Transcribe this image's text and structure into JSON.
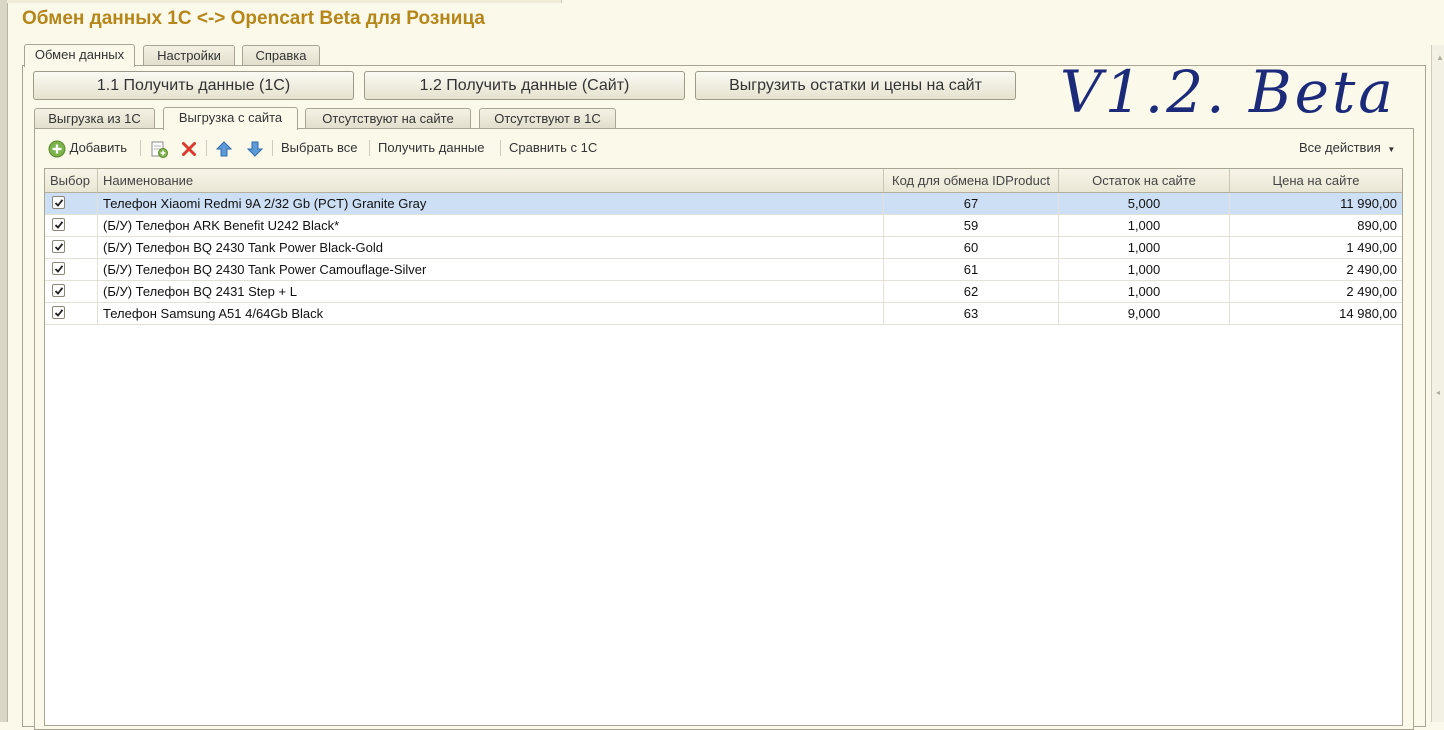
{
  "window": {
    "title": "Обмен данных 1С <-> Opencart Beta для Розница"
  },
  "main_tabs": [
    {
      "label": "Обмен данных",
      "active": true
    },
    {
      "label": "Настройки",
      "active": false
    },
    {
      "label": "Справка",
      "active": false
    }
  ],
  "actions": {
    "get_data_1c": "1.1 Получить данные (1С)",
    "get_data_site": "1.2 Получить данные (Сайт)",
    "upload_stock_prices": "Выгрузить остатки и цены на сайт"
  },
  "signature_text": "V1.2. Beta",
  "sub_tabs": [
    {
      "label": "Выгрузка из 1С",
      "active": false
    },
    {
      "label": "Выгрузка с сайта",
      "active": true
    },
    {
      "label": "Отсутствуют на сайте",
      "active": false
    },
    {
      "label": "Отсутствуют в 1С",
      "active": false
    }
  ],
  "toolbar": {
    "add": "Добавить",
    "select_all": "Выбрать все",
    "get_data": "Получить данные",
    "compare_1c": "Сравнить с 1С",
    "all_actions": "Все действия"
  },
  "table": {
    "columns": [
      "Выбор",
      "Наименование",
      "Код для обмена IDProduct",
      "Остаток на сайте",
      "Цена на сайте"
    ],
    "rows": [
      {
        "checked": true,
        "name": "Телефон Xiaomi Redmi 9A 2/32 Gb (PCT) Granite Gray",
        "id_product": "67",
        "stock": "5,000",
        "price": "11 990,00",
        "selected": true
      },
      {
        "checked": true,
        "name": "(Б/У) Телефон ARK Benefit U242 Black*",
        "id_product": "59",
        "stock": "1,000",
        "price": "890,00",
        "selected": false
      },
      {
        "checked": true,
        "name": "(Б/У) Телефон BQ 2430 Tank Power Black-Gold",
        "id_product": "60",
        "stock": "1,000",
        "price": "1 490,00",
        "selected": false
      },
      {
        "checked": true,
        "name": "(Б/У) Телефон BQ 2430 Tank Power Camouflage-Silver",
        "id_product": "61",
        "stock": "1,000",
        "price": "2 490,00",
        "selected": false
      },
      {
        "checked": true,
        "name": "(Б/У) Телефон BQ 2431 Step + L",
        "id_product": "62",
        "stock": "1,000",
        "price": "2 490,00",
        "selected": false
      },
      {
        "checked": true,
        "name": "Телефон Samsung A51 4/64Gb Black",
        "id_product": "63",
        "stock": "9,000",
        "price": "14 980,00",
        "selected": false
      }
    ]
  },
  "colors": {
    "title": "#b5861a",
    "background": "#fbf9ea",
    "selected_row": "#cddff5",
    "signature": "#1c2a7a"
  }
}
